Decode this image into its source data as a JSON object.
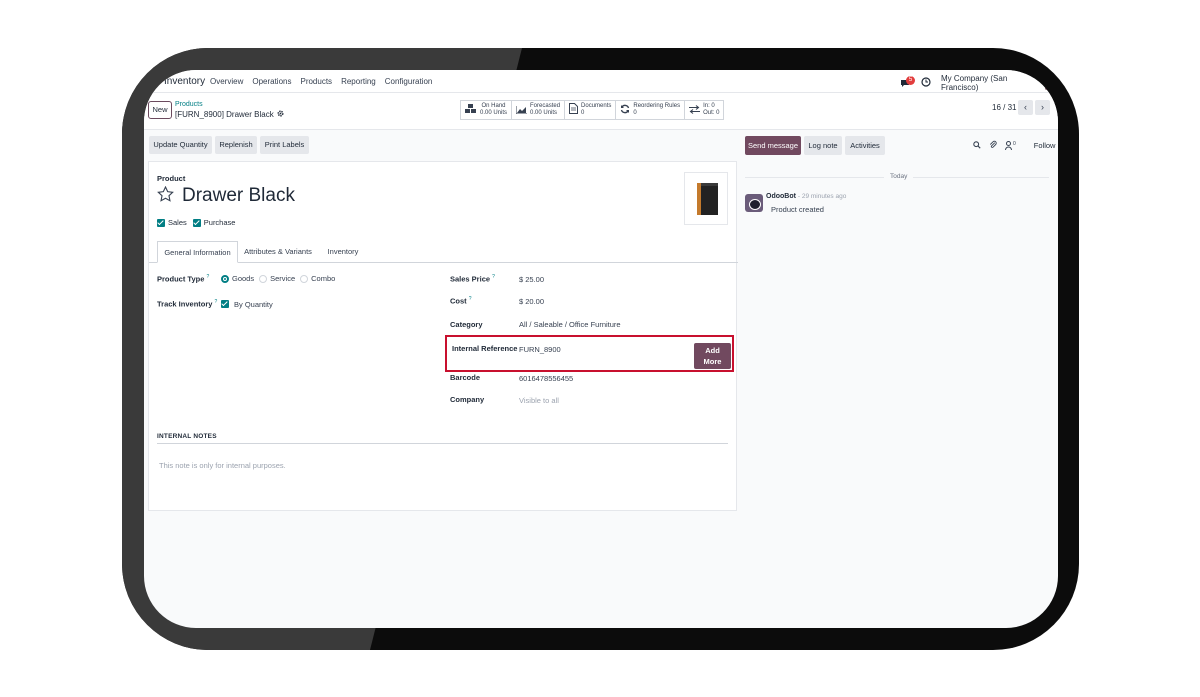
{
  "nav": {
    "app": "Inventory",
    "menu": [
      "Overview",
      "Operations",
      "Products",
      "Reporting",
      "Configuration"
    ],
    "chat_badge": "5",
    "company": "My Company (San Francisco)"
  },
  "control": {
    "new_label": "New",
    "breadcrumb_parent": "Products",
    "breadcrumb_current": "[FURN_8900] Drawer Black",
    "smart_buttons": [
      {
        "icon": "cubes-icon",
        "label": "On Hand",
        "value": "0.00 Units"
      },
      {
        "icon": "area-chart-icon",
        "label": "Forecasted",
        "value": "0.00 Units"
      },
      {
        "icon": "document-icon",
        "label": "Documents",
        "value": "0"
      },
      {
        "icon": "refresh-icon",
        "label": "Reordering Rules",
        "value": "0"
      },
      {
        "icon": "exchange-icon",
        "label": "In: 0",
        "value": "Out: 0"
      }
    ],
    "pager": "16 / 31"
  },
  "actions": [
    "Update Quantity",
    "Replenish",
    "Print Labels"
  ],
  "form": {
    "product_label": "Product",
    "name": "Drawer Black",
    "sales_label": "Sales",
    "purchase_label": "Purchase",
    "tabs": [
      "General Information",
      "Attributes & Variants",
      "Inventory"
    ],
    "product_type_label": "Product Type",
    "product_type_options": [
      "Goods",
      "Service",
      "Combo"
    ],
    "product_type_selected": "Goods",
    "track_inventory_label": "Track Inventory",
    "track_inventory_value": "By Quantity",
    "sales_price_label": "Sales Price",
    "sales_price": "$ 25.00",
    "cost_label": "Cost",
    "cost": "$ 20.00",
    "category_label": "Category",
    "category": "All / Saleable / Office Furniture",
    "internal_ref_label": "Internal Reference",
    "internal_ref": "FURN_8900",
    "add_more_line1": "Add",
    "add_more_line2": "More",
    "barcode_label": "Barcode",
    "barcode": "6016478556455",
    "company_label": "Company",
    "company_placeholder": "Visible to all",
    "notes_title": "INTERNAL NOTES",
    "notes_placeholder": "This note is only for internal purposes."
  },
  "chatter": {
    "send_message": "Send message",
    "log_note": "Log note",
    "activities": "Activities",
    "followers_count": "0",
    "follow": "Follow",
    "date_separator": "Today",
    "author": "OdooBot",
    "time": "- 29 minutes ago",
    "body": "Product created"
  },
  "colors": {
    "accent": "#71495f",
    "teal": "#017e84",
    "highlight": "#c8102e"
  }
}
